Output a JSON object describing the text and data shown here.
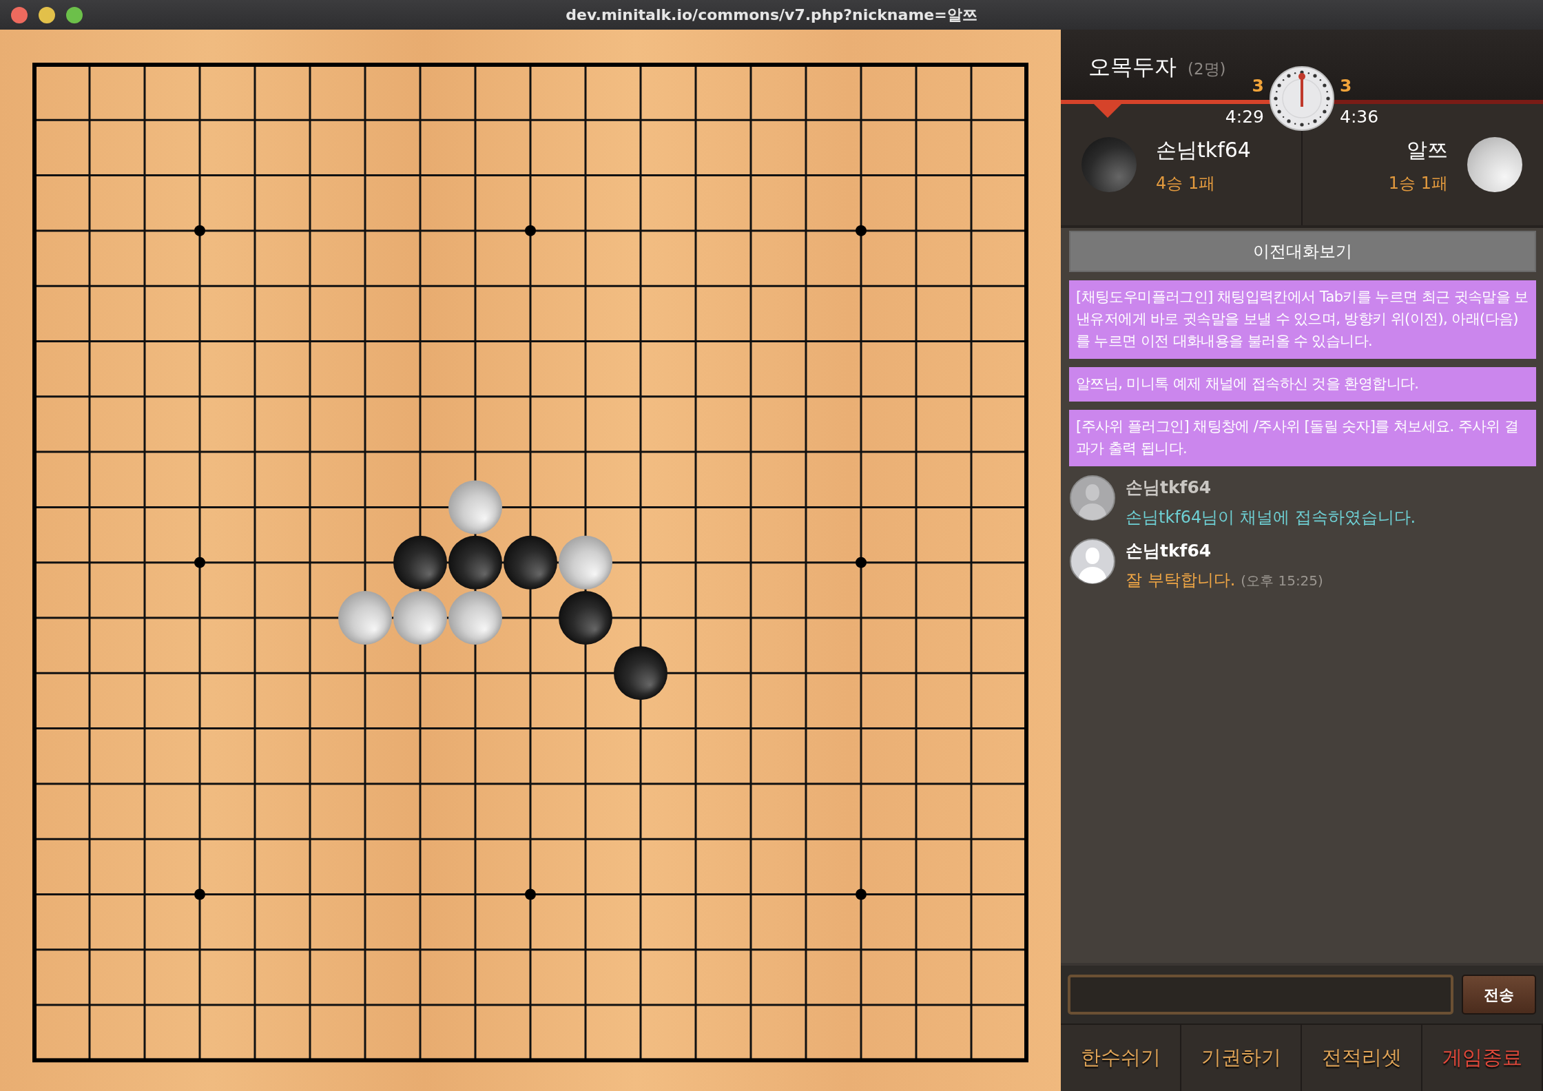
{
  "window": {
    "title": "dev.minitalk.io/commons/v7.php?nickname=알쯔"
  },
  "board": [
    [
      {
        "kind": "empty"
      },
      {
        "kind": "empty"
      },
      {
        "kind": "empty"
      },
      {
        "kind": "empty"
      },
      {
        "kind": "empty"
      },
      {
        "kind": "empty"
      },
      {
        "kind": "empty"
      },
      {
        "kind": "empty"
      },
      {
        "kind": "empty"
      },
      {
        "kind": "empty"
      },
      {
        "kind": "empty"
      },
      {
        "kind": "empty"
      },
      {
        "kind": "empty"
      },
      {
        "kind": "empty"
      },
      {
        "kind": "empty"
      },
      {
        "kind": "empty"
      },
      {
        "kind": "empty"
      },
      {
        "kind": "empty"
      },
      {
        "kind": "empty"
      }
    ],
    [
      {
        "kind": "empty"
      },
      {
        "kind": "empty"
      },
      {
        "kind": "empty"
      },
      {
        "kind": "empty"
      },
      {
        "kind": "empty"
      },
      {
        "kind": "empty"
      },
      {
        "kind": "empty"
      },
      {
        "kind": "empty"
      },
      {
        "kind": "empty"
      },
      {
        "kind": "empty"
      },
      {
        "kind": "empty"
      },
      {
        "kind": "empty"
      },
      {
        "kind": "empty"
      },
      {
        "kind": "empty"
      },
      {
        "kind": "empty"
      },
      {
        "kind": "empty"
      },
      {
        "kind": "empty"
      },
      {
        "kind": "empty"
      },
      {
        "kind": "empty"
      }
    ],
    [
      {
        "kind": "empty"
      },
      {
        "kind": "empty"
      },
      {
        "kind": "empty"
      },
      {
        "kind": "empty"
      },
      {
        "kind": "empty"
      },
      {
        "kind": "empty"
      },
      {
        "kind": "empty"
      },
      {
        "kind": "empty"
      },
      {
        "kind": "empty"
      },
      {
        "kind": "empty"
      },
      {
        "kind": "empty"
      },
      {
        "kind": "empty"
      },
      {
        "kind": "empty"
      },
      {
        "kind": "empty"
      },
      {
        "kind": "empty"
      },
      {
        "kind": "empty"
      },
      {
        "kind": "empty"
      },
      {
        "kind": "empty"
      },
      {
        "kind": "empty"
      }
    ],
    [
      {
        "kind": "empty"
      },
      {
        "kind": "empty"
      },
      {
        "kind": "empty"
      },
      {
        "kind": "empty"
      },
      {
        "kind": "empty"
      },
      {
        "kind": "empty"
      },
      {
        "kind": "empty"
      },
      {
        "kind": "empty"
      },
      {
        "kind": "empty"
      },
      {
        "kind": "empty"
      },
      {
        "kind": "empty"
      },
      {
        "kind": "empty"
      },
      {
        "kind": "empty"
      },
      {
        "kind": "empty"
      },
      {
        "kind": "empty"
      },
      {
        "kind": "empty"
      },
      {
        "kind": "empty"
      },
      {
        "kind": "empty"
      },
      {
        "kind": "empty"
      }
    ],
    [
      {
        "kind": "empty"
      },
      {
        "kind": "empty"
      },
      {
        "kind": "empty"
      },
      {
        "kind": "empty"
      },
      {
        "kind": "empty"
      },
      {
        "kind": "empty"
      },
      {
        "kind": "empty"
      },
      {
        "kind": "empty"
      },
      {
        "kind": "empty"
      },
      {
        "kind": "empty"
      },
      {
        "kind": "empty"
      },
      {
        "kind": "empty"
      },
      {
        "kind": "empty"
      },
      {
        "kind": "empty"
      },
      {
        "kind": "empty"
      },
      {
        "kind": "empty"
      },
      {
        "kind": "empty"
      },
      {
        "kind": "empty"
      },
      {
        "kind": "empty"
      }
    ],
    [
      {
        "kind": "empty"
      },
      {
        "kind": "empty"
      },
      {
        "kind": "empty"
      },
      {
        "kind": "empty"
      },
      {
        "kind": "empty"
      },
      {
        "kind": "empty"
      },
      {
        "kind": "empty"
      },
      {
        "kind": "empty"
      },
      {
        "kind": "empty"
      },
      {
        "kind": "empty"
      },
      {
        "kind": "empty"
      },
      {
        "kind": "empty"
      },
      {
        "kind": "empty"
      },
      {
        "kind": "empty"
      },
      {
        "kind": "empty"
      },
      {
        "kind": "empty"
      },
      {
        "kind": "empty"
      },
      {
        "kind": "empty"
      },
      {
        "kind": "empty"
      }
    ],
    [
      {
        "kind": "empty"
      },
      {
        "kind": "empty"
      },
      {
        "kind": "empty"
      },
      {
        "kind": "empty"
      },
      {
        "kind": "empty"
      },
      {
        "kind": "empty"
      },
      {
        "kind": "empty"
      },
      {
        "kind": "empty"
      },
      {
        "kind": "empty"
      },
      {
        "kind": "empty"
      },
      {
        "kind": "empty"
      },
      {
        "kind": "empty"
      },
      {
        "kind": "empty"
      },
      {
        "kind": "empty"
      },
      {
        "kind": "empty"
      },
      {
        "kind": "empty"
      },
      {
        "kind": "empty"
      },
      {
        "kind": "empty"
      },
      {
        "kind": "empty"
      }
    ],
    [
      {
        "kind": "empty"
      },
      {
        "kind": "empty"
      },
      {
        "kind": "empty"
      },
      {
        "kind": "empty"
      },
      {
        "kind": "empty"
      },
      {
        "kind": "empty"
      },
      {
        "kind": "empty"
      },
      {
        "kind": "empty"
      },
      {
        "kind": "empty"
      },
      {
        "kind": "empty"
      },
      {
        "kind": "empty"
      },
      {
        "kind": "empty"
      },
      {
        "kind": "empty"
      },
      {
        "kind": "empty"
      },
      {
        "kind": "empty"
      },
      {
        "kind": "empty"
      },
      {
        "kind": "empty"
      },
      {
        "kind": "empty"
      },
      {
        "kind": "empty"
      }
    ],
    [
      {
        "kind": "empty"
      },
      {
        "kind": "empty"
      },
      {
        "kind": "empty"
      },
      {
        "kind": "empty"
      },
      {
        "kind": "empty"
      },
      {
        "kind": "empty"
      },
      {
        "kind": "empty"
      },
      {
        "kind": "empty"
      },
      {
        "kind": "white"
      },
      {
        "kind": "empty"
      },
      {
        "kind": "empty"
      },
      {
        "kind": "empty"
      },
      {
        "kind": "empty"
      },
      {
        "kind": "empty"
      },
      {
        "kind": "empty"
      },
      {
        "kind": "empty"
      },
      {
        "kind": "empty"
      },
      {
        "kind": "empty"
      },
      {
        "kind": "empty"
      }
    ],
    [
      {
        "kind": "empty"
      },
      {
        "kind": "empty"
      },
      {
        "kind": "empty"
      },
      {
        "kind": "empty"
      },
      {
        "kind": "empty"
      },
      {
        "kind": "empty"
      },
      {
        "kind": "empty"
      },
      {
        "kind": "black"
      },
      {
        "kind": "black"
      },
      {
        "kind": "black"
      },
      {
        "kind": "white"
      },
      {
        "kind": "empty"
      },
      {
        "kind": "empty"
      },
      {
        "kind": "empty"
      },
      {
        "kind": "empty"
      },
      {
        "kind": "empty"
      },
      {
        "kind": "empty"
      },
      {
        "kind": "empty"
      },
      {
        "kind": "empty"
      }
    ],
    [
      {
        "kind": "empty"
      },
      {
        "kind": "empty"
      },
      {
        "kind": "empty"
      },
      {
        "kind": "empty"
      },
      {
        "kind": "empty"
      },
      {
        "kind": "empty"
      },
      {
        "kind": "white"
      },
      {
        "kind": "white"
      },
      {
        "kind": "white"
      },
      {
        "kind": "empty"
      },
      {
        "kind": "black"
      },
      {
        "kind": "empty"
      },
      {
        "kind": "empty"
      },
      {
        "kind": "empty"
      },
      {
        "kind": "empty"
      },
      {
        "kind": "empty"
      },
      {
        "kind": "empty"
      },
      {
        "kind": "empty"
      },
      {
        "kind": "empty"
      }
    ],
    [
      {
        "kind": "empty"
      },
      {
        "kind": "empty"
      },
      {
        "kind": "empty"
      },
      {
        "kind": "empty"
      },
      {
        "kind": "empty"
      },
      {
        "kind": "empty"
      },
      {
        "kind": "empty"
      },
      {
        "kind": "empty"
      },
      {
        "kind": "empty"
      },
      {
        "kind": "empty"
      },
      {
        "kind": "empty"
      },
      {
        "kind": "black"
      },
      {
        "kind": "empty"
      },
      {
        "kind": "empty"
      },
      {
        "kind": "empty"
      },
      {
        "kind": "empty"
      },
      {
        "kind": "empty"
      },
      {
        "kind": "empty"
      },
      {
        "kind": "empty"
      }
    ],
    [
      {
        "kind": "empty"
      },
      {
        "kind": "empty"
      },
      {
        "kind": "empty"
      },
      {
        "kind": "empty"
      },
      {
        "kind": "empty"
      },
      {
        "kind": "empty"
      },
      {
        "kind": "empty"
      },
      {
        "kind": "empty"
      },
      {
        "kind": "empty"
      },
      {
        "kind": "empty"
      },
      {
        "kind": "empty"
      },
      {
        "kind": "empty"
      },
      {
        "kind": "empty"
      },
      {
        "kind": "empty"
      },
      {
        "kind": "empty"
      },
      {
        "kind": "empty"
      },
      {
        "kind": "empty"
      },
      {
        "kind": "empty"
      },
      {
        "kind": "empty"
      }
    ],
    [
      {
        "kind": "empty"
      },
      {
        "kind": "empty"
      },
      {
        "kind": "empty"
      },
      {
        "kind": "empty"
      },
      {
        "kind": "empty"
      },
      {
        "kind": "empty"
      },
      {
        "kind": "empty"
      },
      {
        "kind": "empty"
      },
      {
        "kind": "empty"
      },
      {
        "kind": "empty"
      },
      {
        "kind": "empty"
      },
      {
        "kind": "empty"
      },
      {
        "kind": "empty"
      },
      {
        "kind": "empty"
      },
      {
        "kind": "empty"
      },
      {
        "kind": "empty"
      },
      {
        "kind": "empty"
      },
      {
        "kind": "empty"
      },
      {
        "kind": "empty"
      }
    ],
    [
      {
        "kind": "empty"
      },
      {
        "kind": "empty"
      },
      {
        "kind": "empty"
      },
      {
        "kind": "empty"
      },
      {
        "kind": "empty"
      },
      {
        "kind": "empty"
      },
      {
        "kind": "empty"
      },
      {
        "kind": "empty"
      },
      {
        "kind": "empty"
      },
      {
        "kind": "empty"
      },
      {
        "kind": "empty"
      },
      {
        "kind": "empty"
      },
      {
        "kind": "empty"
      },
      {
        "kind": "empty"
      },
      {
        "kind": "empty"
      },
      {
        "kind": "empty"
      },
      {
        "kind": "empty"
      },
      {
        "kind": "empty"
      },
      {
        "kind": "empty"
      }
    ],
    [
      {
        "kind": "empty"
      },
      {
        "kind": "empty"
      },
      {
        "kind": "empty"
      },
      {
        "kind": "empty"
      },
      {
        "kind": "empty"
      },
      {
        "kind": "empty"
      },
      {
        "kind": "empty"
      },
      {
        "kind": "empty"
      },
      {
        "kind": "empty"
      },
      {
        "kind": "empty"
      },
      {
        "kind": "empty"
      },
      {
        "kind": "empty"
      },
      {
        "kind": "empty"
      },
      {
        "kind": "empty"
      },
      {
        "kind": "empty"
      },
      {
        "kind": "empty"
      },
      {
        "kind": "empty"
      },
      {
        "kind": "empty"
      },
      {
        "kind": "empty"
      }
    ],
    [
      {
        "kind": "empty"
      },
      {
        "kind": "empty"
      },
      {
        "kind": "empty"
      },
      {
        "kind": "empty"
      },
      {
        "kind": "empty"
      },
      {
        "kind": "empty"
      },
      {
        "kind": "empty"
      },
      {
        "kind": "empty"
      },
      {
        "kind": "empty"
      },
      {
        "kind": "empty"
      },
      {
        "kind": "empty"
      },
      {
        "kind": "empty"
      },
      {
        "kind": "empty"
      },
      {
        "kind": "empty"
      },
      {
        "kind": "empty"
      },
      {
        "kind": "empty"
      },
      {
        "kind": "empty"
      },
      {
        "kind": "empty"
      },
      {
        "kind": "empty"
      }
    ],
    [
      {
        "kind": "empty"
      },
      {
        "kind": "empty"
      },
      {
        "kind": "empty"
      },
      {
        "kind": "empty"
      },
      {
        "kind": "empty"
      },
      {
        "kind": "empty"
      },
      {
        "kind": "empty"
      },
      {
        "kind": "empty"
      },
      {
        "kind": "empty"
      },
      {
        "kind": "empty"
      },
      {
        "kind": "empty"
      },
      {
        "kind": "empty"
      },
      {
        "kind": "empty"
      },
      {
        "kind": "empty"
      },
      {
        "kind": "empty"
      },
      {
        "kind": "empty"
      },
      {
        "kind": "empty"
      },
      {
        "kind": "empty"
      },
      {
        "kind": "empty"
      }
    ],
    [
      {
        "kind": "empty"
      },
      {
        "kind": "empty"
      },
      {
        "kind": "empty"
      },
      {
        "kind": "empty"
      },
      {
        "kind": "empty"
      },
      {
        "kind": "empty"
      },
      {
        "kind": "empty"
      },
      {
        "kind": "empty"
      },
      {
        "kind": "empty"
      },
      {
        "kind": "empty"
      },
      {
        "kind": "empty"
      },
      {
        "kind": "empty"
      },
      {
        "kind": "empty"
      },
      {
        "kind": "empty"
      },
      {
        "kind": "empty"
      },
      {
        "kind": "empty"
      },
      {
        "kind": "empty"
      },
      {
        "kind": "empty"
      },
      {
        "kind": "empty"
      }
    ]
  ],
  "room": {
    "title": "오목두자",
    "count": "(2명)"
  },
  "players": [
    {
      "name": "손님tkf64",
      "record": "4승 1패",
      "kind": "black",
      "count": "3",
      "time": "4:29",
      "turn": true
    },
    {
      "name": "알쯔",
      "record": "1승 1패",
      "kind": "white",
      "count": "3",
      "time": "4:36",
      "turn": false
    }
  ],
  "chat": {
    "history_button": "이전대화보기",
    "messages": [
      {
        "kind": "notice",
        "text": "[채팅도우미플러그인] 채팅입력칸에서 Tab키를 누르면 최근 귓속말을 보낸유저에게 바로 귓속말을 보낼 수 있으며, 방향키 위(이전), 아래(다음)를 누르면 이전 대화내용을 불러올 수 있습니다."
      },
      {
        "kind": "notice",
        "text": "알쯔님, 미니톡 예제 채널에 접속하신 것을 환영합니다."
      },
      {
        "kind": "notice",
        "text": "[주사위 플러그인] 채팅창에 /주사위 [돌릴 숫자]를 쳐보세요. 주사위 결과가 출력 됩니다."
      },
      {
        "kind": "system",
        "name": "손님tkf64",
        "text": "손님tkf64님이 채널에 접속하였습니다."
      },
      {
        "kind": "chat",
        "name": "손님tkf64",
        "text": "잘 부탁합니다.",
        "time": "(오후 15:25)"
      }
    ]
  },
  "send_button": "전송",
  "actions": [
    {
      "label": "한수쉬기",
      "color": "#e0a457"
    },
    {
      "label": "기권하기",
      "color": "#e0a457"
    },
    {
      "label": "전적리셋",
      "color": "#e0a457"
    },
    {
      "label": "게임종료",
      "color": "#e2483a"
    }
  ]
}
